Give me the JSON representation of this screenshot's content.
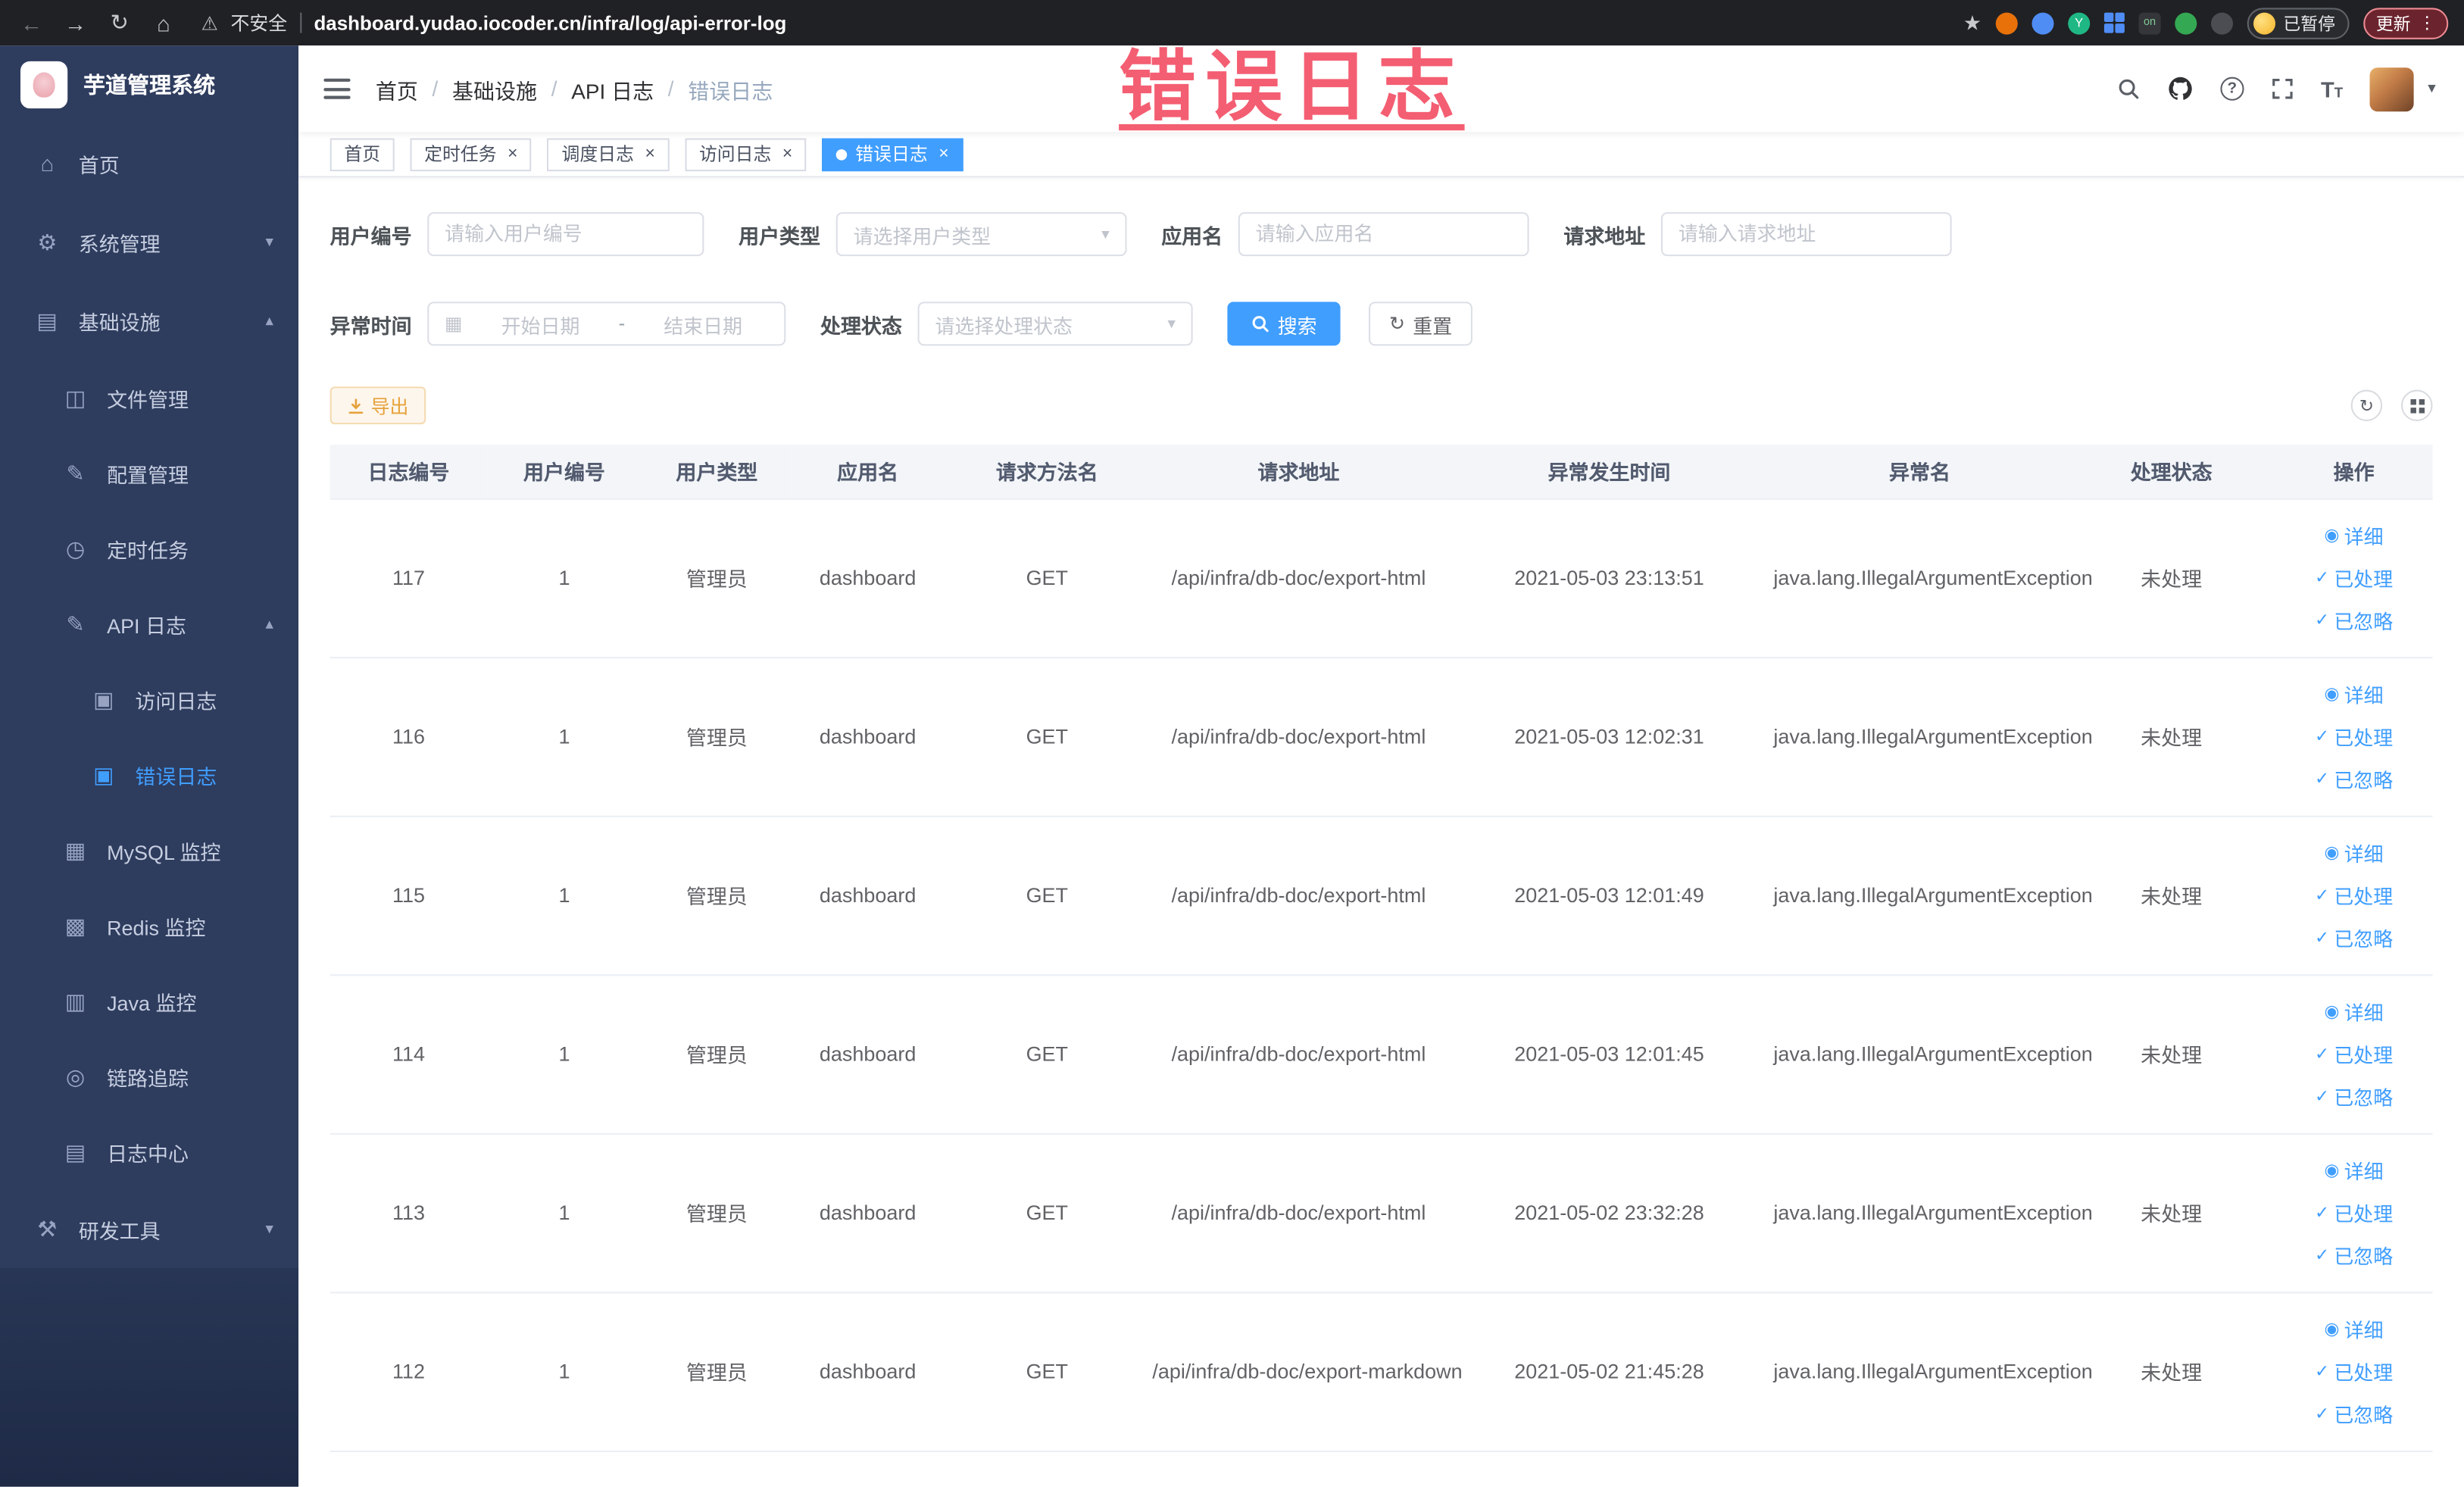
{
  "colors": {
    "accent": "#409eff",
    "warning": "#e6a23c",
    "annotation": "#f2485e",
    "sidebar_bg": "#2e3c5e",
    "tab_active_bg": "#409eff"
  },
  "icons": {
    "back": "←",
    "forward": "→",
    "reload": "↻",
    "home": "⌂",
    "warning": "⚠",
    "star": "★",
    "menu_dots": "⋮",
    "close": "×",
    "chevron_down": "▾",
    "chevron_up": "▴",
    "caret_down": "▾",
    "nav_home": "⌂",
    "gear": "⚙",
    "infra": "▤",
    "file": "◫",
    "config": "✎",
    "timer": "◷",
    "api_log": "✎",
    "access_log": "▣",
    "error_log": "▣",
    "mysql": "▦",
    "redis": "▩",
    "java": "▥",
    "trace": "◎",
    "log_center": "▤",
    "devtools": "⚒",
    "calendar": "▦",
    "refresh": "↻",
    "eye": "◉",
    "check": "✓",
    "question": "?",
    "on_badge": "on"
  },
  "browser": {
    "security_label": "不安全",
    "url": "dashboard.yudao.iocoder.cn/infra/log/api-error-log",
    "paused_label": "已暂停",
    "update_label": "更新"
  },
  "annotation": {
    "text": "错误日志"
  },
  "sidebar": {
    "app_title": "芋道管理系统",
    "items": [
      {
        "label": "首页"
      },
      {
        "label": "系统管理"
      },
      {
        "label": "基础设施"
      },
      {
        "label": "文件管理"
      },
      {
        "label": "配置管理"
      },
      {
        "label": "定时任务"
      },
      {
        "label": "API 日志"
      },
      {
        "label": "访问日志"
      },
      {
        "label": "错误日志"
      },
      {
        "label": "MySQL 监控"
      },
      {
        "label": "Redis 监控"
      },
      {
        "label": "Java 监控"
      },
      {
        "label": "链路追踪"
      },
      {
        "label": "日志中心"
      },
      {
        "label": "研发工具"
      }
    ]
  },
  "header": {
    "breadcrumb": [
      "首页",
      "基础设施",
      "API 日志",
      "错误日志"
    ],
    "separator": "/"
  },
  "tabs": [
    {
      "label": "首页"
    },
    {
      "label": "定时任务"
    },
    {
      "label": "调度日志"
    },
    {
      "label": "访问日志"
    },
    {
      "label": "错误日志"
    }
  ],
  "filters": {
    "user_id": {
      "label": "用户编号",
      "placeholder": "请输入用户编号"
    },
    "user_type": {
      "label": "用户类型",
      "placeholder": "请选择用户类型"
    },
    "app_name": {
      "label": "应用名",
      "placeholder": "请输入应用名"
    },
    "request_url": {
      "label": "请求地址",
      "placeholder": "请输入请求地址"
    },
    "exception_time": {
      "label": "异常时间",
      "start_placeholder": "开始日期",
      "separator": "-",
      "end_placeholder": "结束日期"
    },
    "process_status": {
      "label": "处理状态",
      "placeholder": "请选择处理状态"
    },
    "search_label": "搜索",
    "reset_label": "重置"
  },
  "toolbar": {
    "export_label": "导出"
  },
  "table": {
    "columns": [
      "日志编号",
      "用户编号",
      "用户类型",
      "应用名",
      "请求方法名",
      "请求地址",
      "异常发生时间",
      "异常名",
      "处理状态",
      "操作"
    ],
    "actions": [
      "详细",
      "已处理",
      "已忽略"
    ],
    "rows": [
      {
        "id": "117",
        "user_id": "1",
        "user_type": "管理员",
        "app": "dashboard",
        "method": "GET",
        "url": "/api/infra/db-doc/export-html",
        "time": "2021-05-03 23:13:51",
        "exception": "java.lang.IllegalArgumentException",
        "status": "未处理"
      },
      {
        "id": "116",
        "user_id": "1",
        "user_type": "管理员",
        "app": "dashboard",
        "method": "GET",
        "url": "/api/infra/db-doc/export-html",
        "time": "2021-05-03 12:02:31",
        "exception": "java.lang.IllegalArgumentException",
        "status": "未处理"
      },
      {
        "id": "115",
        "user_id": "1",
        "user_type": "管理员",
        "app": "dashboard",
        "method": "GET",
        "url": "/api/infra/db-doc/export-html",
        "time": "2021-05-03 12:01:49",
        "exception": "java.lang.IllegalArgumentException",
        "status": "未处理"
      },
      {
        "id": "114",
        "user_id": "1",
        "user_type": "管理员",
        "app": "dashboard",
        "method": "GET",
        "url": "/api/infra/db-doc/export-html",
        "time": "2021-05-03 12:01:45",
        "exception": "java.lang.IllegalArgumentException",
        "status": "未处理"
      },
      {
        "id": "113",
        "user_id": "1",
        "user_type": "管理员",
        "app": "dashboard",
        "method": "GET",
        "url": "/api/infra/db-doc/export-html",
        "time": "2021-05-02 23:32:28",
        "exception": "java.lang.IllegalArgumentException",
        "status": "未处理"
      },
      {
        "id": "112",
        "user_id": "1",
        "user_type": "管理员",
        "app": "dashboard",
        "method": "GET",
        "url": "/api/infra/db-doc/export-markdown",
        "time": "2021-05-02 21:45:28",
        "exception": "java.lang.IllegalArgumentException",
        "status": "未处理"
      }
    ]
  }
}
